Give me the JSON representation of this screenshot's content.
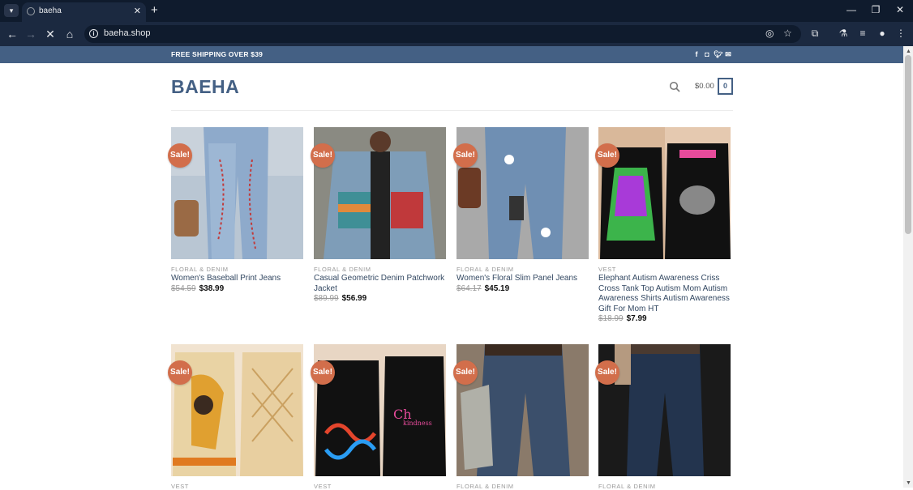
{
  "browser": {
    "tab_title": "baeha",
    "url": "baeha.shop",
    "icons": [
      "tab-search-icon",
      "close-icon",
      "new-tab-icon",
      "minimize-icon",
      "restore-icon",
      "window-close-icon",
      "back-icon",
      "forward-icon",
      "stop-icon",
      "home-icon",
      "site-info-icon",
      "eye-off-icon",
      "star-icon",
      "extensions-icon",
      "labs-icon",
      "media-icon",
      "profile-icon",
      "menu-icon"
    ]
  },
  "topbar": {
    "shipping_text": "FREE SHIPPING OVER $39",
    "social": [
      "facebook-icon",
      "instagram-icon",
      "twitter-icon",
      "email-icon"
    ]
  },
  "header": {
    "logo": "BAEHA",
    "cart_amount": "$0.00",
    "cart_count": "0"
  },
  "products": [
    {
      "badge": "Sale!",
      "category": "FLORAL & DENIM",
      "name": "Women's Baseball Print Jeans",
      "old_price": "$54.59",
      "price": "$38.99"
    },
    {
      "badge": "Sale!",
      "category": "FLORAL & DENIM",
      "name": "Casual Geometric Denim Patchwork Jacket",
      "old_price": "$89.99",
      "price": "$56.99"
    },
    {
      "badge": "Sale!",
      "category": "FLORAL & DENIM",
      "name": "Women's Floral Slim Panel Jeans",
      "old_price": "$64.17",
      "price": "$45.19"
    },
    {
      "badge": "Sale!",
      "category": "VEST",
      "name": "Elephant Autism Awareness Criss Cross Tank Top Autism Mom Autism Awareness Shirts Autism Awareness Gift For Mom HT",
      "old_price": "$18.99",
      "price": "$7.99"
    },
    {
      "badge": "Sale!",
      "category": "VEST"
    },
    {
      "badge": "Sale!",
      "category": "VEST"
    },
    {
      "badge": "Sale!",
      "category": "FLORAL & DENIM"
    },
    {
      "badge": "Sale!",
      "category": "FLORAL & DENIM"
    }
  ],
  "colors": {
    "brand": "#446084",
    "sale_badge": "#d26e4b",
    "link": "#334862"
  }
}
